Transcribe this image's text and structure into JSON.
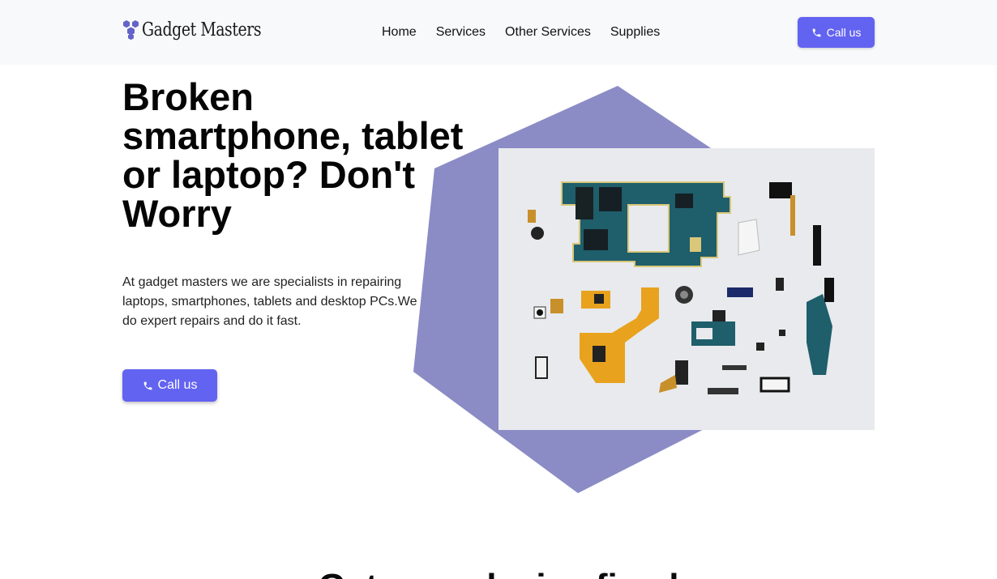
{
  "brand": {
    "name": "Gadget Masters",
    "icon": "hexagon-cluster-icon",
    "accent_color": "#6363f1",
    "hexagon_color": "#8b8bc6"
  },
  "nav": {
    "links": [
      "Home",
      "Services",
      "Other Services",
      "Supplies"
    ],
    "call_label": "Call us",
    "call_icon": "phone-icon"
  },
  "hero": {
    "title": "Broken smartphone, tablet or laptop? Don't Worry",
    "description": "At gadget masters we are specialists in repairing laptops, smartphones, tablets and desktop PCs.We do expert repairs and do it fast.",
    "call_label": "Call us",
    "call_icon": "phone-icon",
    "image": "disassembled-phone-parts-image"
  },
  "next_section": {
    "title": "Get your device fixed"
  }
}
